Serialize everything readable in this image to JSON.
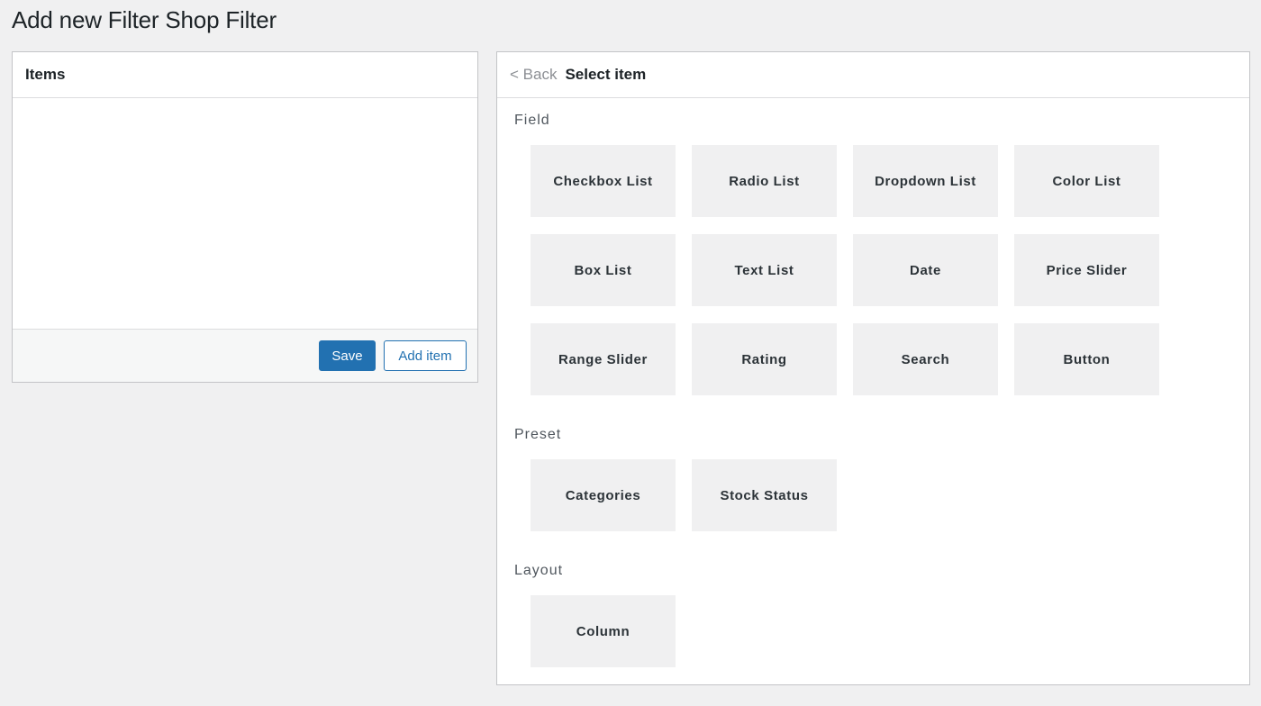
{
  "page": {
    "title": "Add new Filter Shop Filter"
  },
  "items_panel": {
    "title": "Items",
    "save_label": "Save",
    "add_item_label": "Add item"
  },
  "select_panel": {
    "back_label": "< Back",
    "title": "Select item",
    "sections": {
      "field": {
        "label": "Field",
        "items": [
          "Checkbox List",
          "Radio List",
          "Dropdown List",
          "Color List",
          "Box List",
          "Text List",
          "Date",
          "Price Slider",
          "Range Slider",
          "Rating",
          "Search",
          "Button"
        ]
      },
      "preset": {
        "label": "Preset",
        "items": [
          "Categories",
          "Stock Status"
        ]
      },
      "layout": {
        "label": "Layout",
        "items": [
          "Column"
        ]
      }
    }
  },
  "colors": {
    "background": "#f0f0f1",
    "primary": "#2271b1",
    "tile": "#f0f0f1"
  }
}
